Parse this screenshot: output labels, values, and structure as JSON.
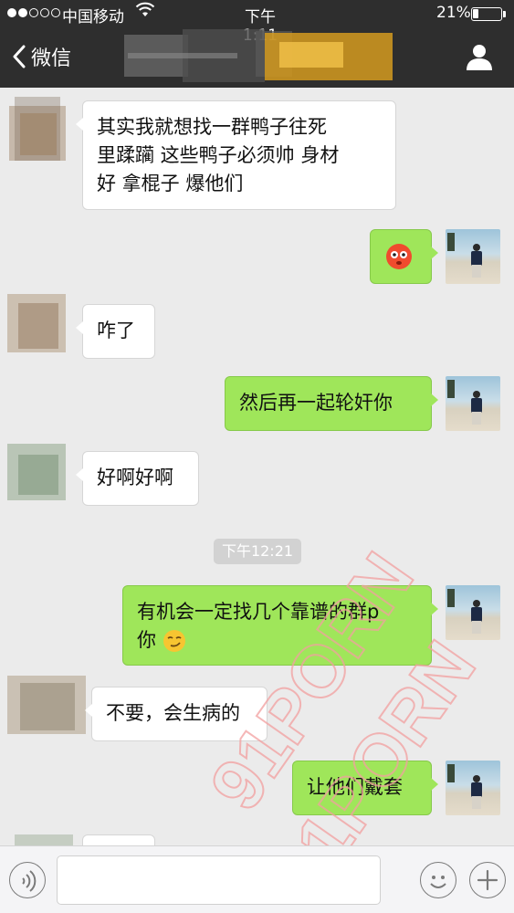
{
  "status_bar": {
    "carrier": "中国移动",
    "time": "下午1:11",
    "battery_percent_label": "21%",
    "battery_level": 0.21
  },
  "nav": {
    "back_label": "微信",
    "back_icon": "chevron-left-icon",
    "contact_icon": "person-icon"
  },
  "messages": [
    {
      "from": "them",
      "text": "其实我就想找一群鸭子往死里蹂躏 这些鸭子必须帅 身材好 拿棍子 爆他们",
      "lines": [
        "其实我就想找一群鸭子往死",
        "里蹂躏  这些鸭子必须帅 身材",
        "好  拿棍子  爆他们"
      ]
    },
    {
      "from": "me",
      "text": "",
      "emoji": "flushed-face-emoji"
    },
    {
      "from": "them",
      "text": "咋了"
    },
    {
      "from": "me",
      "text": "然后再一起轮奸你"
    },
    {
      "from": "them",
      "text": "好啊好啊"
    },
    {
      "from": "me",
      "lines": [
        "有机会一定找几个靠谱的群p",
        "你"
      ],
      "emoji": "smirk-face-emoji"
    },
    {
      "from": "them",
      "text": "不要，会生病的"
    },
    {
      "from": "me",
      "text": "让他们戴套"
    }
  ],
  "timestamp": "下午12:21",
  "watermark": "91PORN",
  "colors": {
    "topbar": "#2e2e2e",
    "chat_bg": "#ebebeb",
    "my_bubble": "#9fe65a",
    "their_bubble": "#ffffff",
    "watermark": "#f2a0a0"
  },
  "input_bar": {
    "voice_icon": "voice-icon",
    "emoji_icon": "emoji-face-icon",
    "plus_icon": "plus-icon",
    "text_value": ""
  }
}
